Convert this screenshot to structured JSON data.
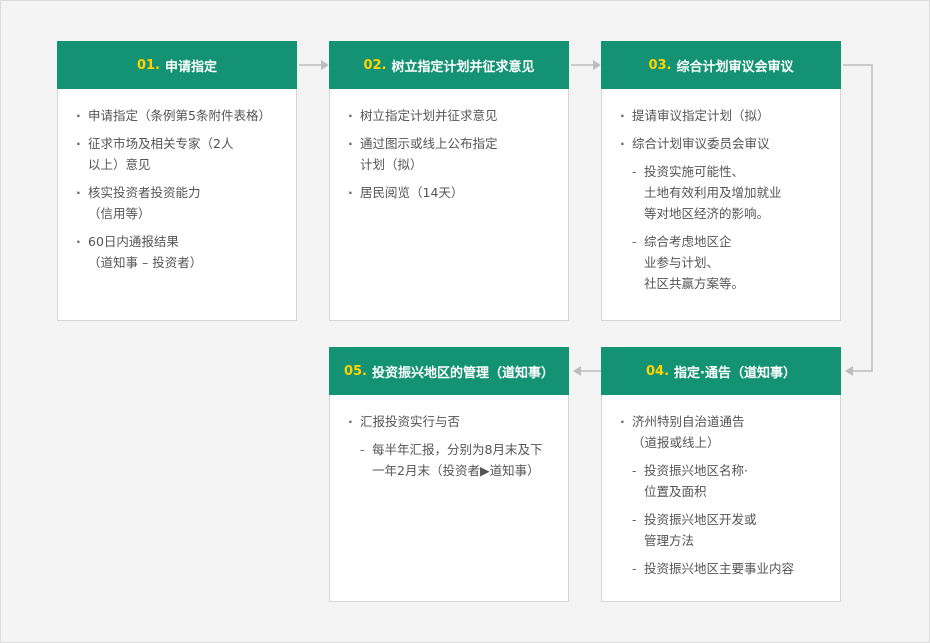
{
  "steps": [
    {
      "num": "01.",
      "title": "申请指定",
      "items": [
        {
          "type": "bullet",
          "text": "申请指定（条例第5条附件表格）"
        },
        {
          "type": "bullet",
          "text": "征求市场及相关专家（2人\n以上）意见"
        },
        {
          "type": "bullet",
          "text": "核实投资者投资能力\n（信用等）"
        },
        {
          "type": "bullet",
          "text": "60日内通报结果\n（道知事 – 投资者）"
        }
      ]
    },
    {
      "num": "02.",
      "title": "树立指定计划并征求意见",
      "items": [
        {
          "type": "bullet",
          "text": "树立指定计划并征求意见"
        },
        {
          "type": "bullet",
          "text": "通过图示或线上公布指定\n计划（拟）"
        },
        {
          "type": "bullet",
          "text": "居民阅览（14天）"
        }
      ]
    },
    {
      "num": "03.",
      "title": "综合计划审议会审议",
      "items": [
        {
          "type": "bullet",
          "text": "提请审议指定计划（拟）"
        },
        {
          "type": "bullet",
          "text": "综合计划审议委员会审议"
        },
        {
          "type": "sub",
          "text": "投资实施可能性、\n土地有效利用及增加就业\n等对地区经济的影响。"
        },
        {
          "type": "sub",
          "text": "综合考虑地区企\n业参与计划、\n社区共赢方案等。"
        }
      ]
    },
    {
      "num": "04.",
      "title": "指定·通告（道知事）",
      "items": [
        {
          "type": "bullet",
          "text": "济州特别自治道通告\n（道报或线上）"
        },
        {
          "type": "sub",
          "text": "投资振兴地区名称·\n位置及面积"
        },
        {
          "type": "sub",
          "text": "投资振兴地区开发或\n管理方法"
        },
        {
          "type": "sub",
          "text": "投资振兴地区主要事业内容"
        }
      ]
    },
    {
      "num": "05.",
      "title": "投资振兴地区的管理（道知事）",
      "items": [
        {
          "type": "bullet",
          "text": "汇报投资实行与否"
        },
        {
          "type": "sub",
          "text": "每半年汇报，分别为8月末及下\n一年2月末（投资者▶道知事）"
        }
      ]
    }
  ],
  "colors": {
    "header": "#139373",
    "number": "#ffd200",
    "connector": "#bdbdbd"
  }
}
